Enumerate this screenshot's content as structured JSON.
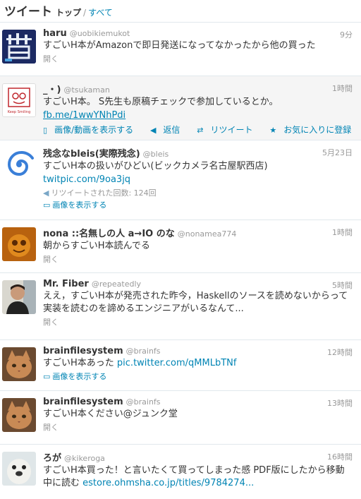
{
  "header": {
    "title": "ツイート",
    "top": "トップ",
    "sep": "/",
    "all": "すべて"
  },
  "tweets": [
    {
      "name": "haru",
      "handle": "@uobikiemukot",
      "time": "9分",
      "text": "すごいH本がAmazonで即日発送になってなかったから他の買った",
      "expand": "開く"
    },
    {
      "name": "_・)",
      "handle": "@tsukaman",
      "time": "1時間",
      "text": "すごいH本。 S先生も原稿チェックで参加しているとか。",
      "link": "fb.me/1wwYNhPdi",
      "avatar_text": "Keep Smiling",
      "actions": {
        "media": "画像/動画を表示する",
        "reply": "返信",
        "retweet": "リツイート",
        "fav": "お気に入りに登録"
      }
    },
    {
      "name": "残念なbleis(実際残念)",
      "handle": "@bleis",
      "time": "5月23日",
      "text": "すごいH本の扱いがひどい(ビックカメラ名古屋駅西店)",
      "link": "twitpic.com/9oa3jq",
      "rt": "リツイートされた回数: 124回",
      "media": "画像を表示する"
    },
    {
      "name": "nona ::名無しの人 a→IO のな",
      "handle": "@nonamea774",
      "time": "1時間",
      "text": "朝からすごいH本読んでる",
      "expand": "開く"
    },
    {
      "name": "Mr. Fiber",
      "handle": "@repeatedly",
      "time": "5時間",
      "text": "ええ，すごいH本が発売された昨今，Haskellのソースを読めないからって実装を読むのを諦めるエンジニアがいるなんて...",
      "expand": "開く"
    },
    {
      "name": "brainfilesystem",
      "handle": "@brainfs",
      "time": "12時間",
      "text": "すごいH本あった ",
      "link": "pic.twitter.com/qMMLbTNf",
      "media": "画像を表示する"
    },
    {
      "name": "brainfilesystem",
      "handle": "@brainfs",
      "time": "13時間",
      "text": "すごいH本ください@ジュンク堂",
      "expand": "開く"
    },
    {
      "name": "ろが",
      "handle": "@kikeroga",
      "time": "16時間",
      "text": "すごいH本買った！と言いたくて買ってしまった感 PDF版にしたから移動中に読む ",
      "link": "estore.ohmsha.co.jp/titles/9784274..."
    }
  ]
}
